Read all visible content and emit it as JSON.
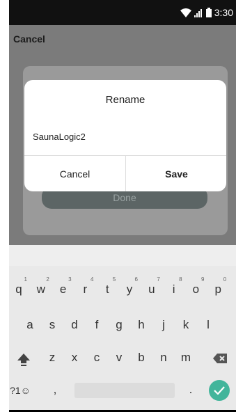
{
  "status_bar": {
    "time": "3:30"
  },
  "topbar": {
    "cancel_label": "Cancel"
  },
  "background": {
    "done_label": "Done"
  },
  "dialog": {
    "title": "Rename",
    "input_value": "SaunaLogic2",
    "cancel_label": "Cancel",
    "save_label": "Save"
  },
  "keyboard": {
    "row1": [
      {
        "key": "q",
        "hint": "1"
      },
      {
        "key": "w",
        "hint": "2"
      },
      {
        "key": "e",
        "hint": "3"
      },
      {
        "key": "r",
        "hint": "4"
      },
      {
        "key": "t",
        "hint": "5"
      },
      {
        "key": "y",
        "hint": "6"
      },
      {
        "key": "u",
        "hint": "7"
      },
      {
        "key": "i",
        "hint": "8"
      },
      {
        "key": "o",
        "hint": "9"
      },
      {
        "key": "p",
        "hint": "0"
      }
    ],
    "row2": [
      "a",
      "s",
      "d",
      "f",
      "g",
      "h",
      "j",
      "k",
      "l"
    ],
    "row3": [
      "z",
      "x",
      "c",
      "v",
      "b",
      "n",
      "m"
    ],
    "symbols_label": "?1☺",
    "comma_label": ",",
    "period_label": ".",
    "accent_color": "#42b59b"
  }
}
